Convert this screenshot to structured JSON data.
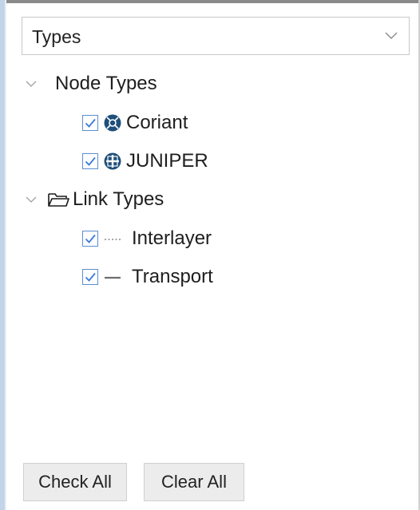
{
  "dropdown": {
    "selected": "Types"
  },
  "tree": {
    "node_group": {
      "label": "Node Types",
      "items": [
        {
          "label": "Coriant",
          "checked": true,
          "icon": "coriant-icon"
        },
        {
          "label": "JUNIPER",
          "checked": true,
          "icon": "juniper-icon"
        }
      ]
    },
    "link_group": {
      "label": "Link Types",
      "icon": "folder-icon",
      "items": [
        {
          "label": "Interlayer",
          "checked": true,
          "icon": "dotted-line-icon"
        },
        {
          "label": "Transport",
          "checked": true,
          "icon": "solid-line-icon"
        }
      ]
    }
  },
  "buttons": {
    "check_all": "Check All",
    "clear_all": "Clear All"
  },
  "colors": {
    "accent": "#3b7bd6",
    "node_icon": "#1f4f7a",
    "panel_border": "#c3d3e8"
  }
}
